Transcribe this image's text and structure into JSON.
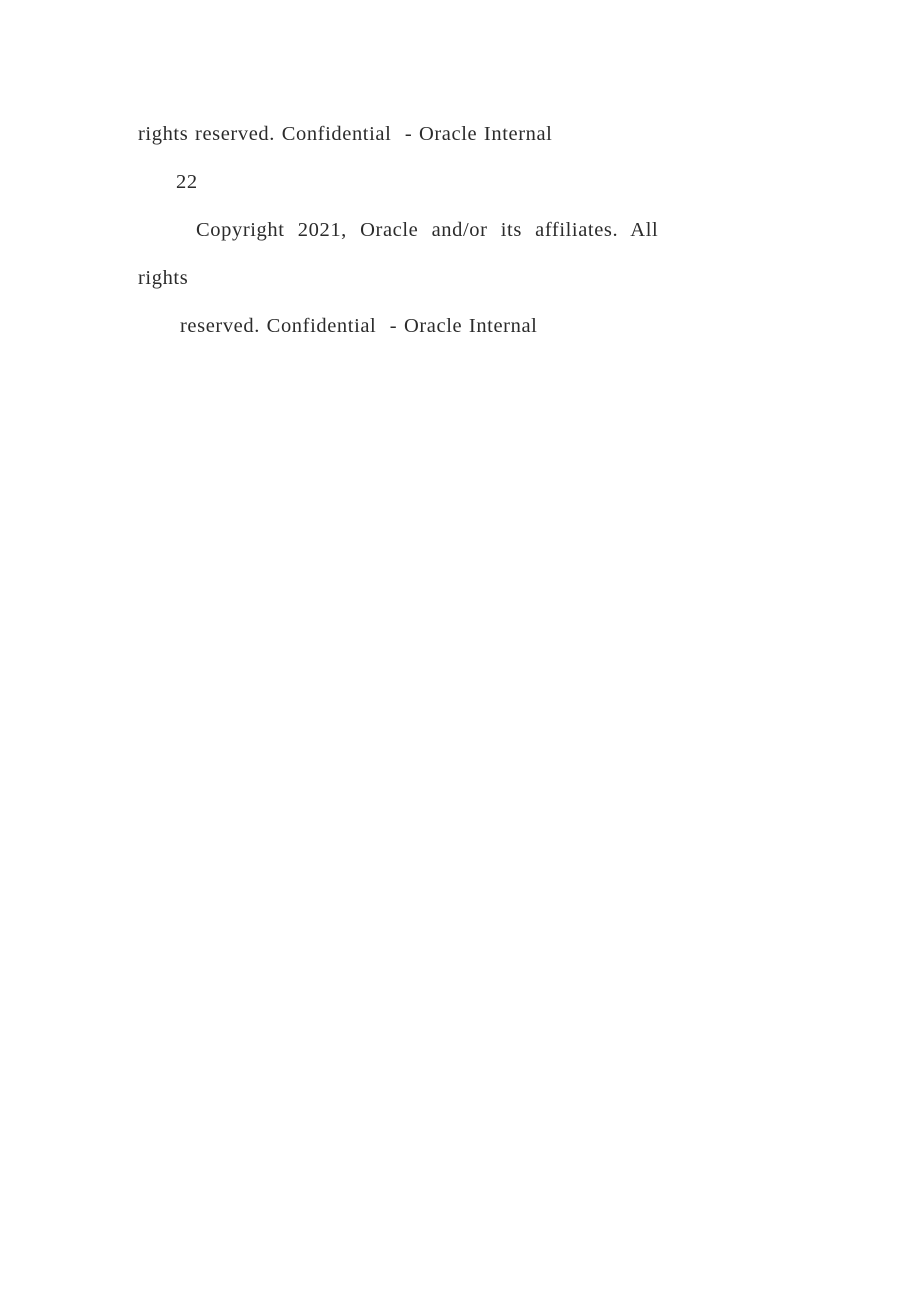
{
  "document": {
    "page_background": "#ffffff",
    "text_color": "#2b2b2b",
    "page_number": "22",
    "lines": [
      {
        "id": "line-1",
        "text": "rights reserved. Confidential  - Oracle Internal",
        "indent": "none",
        "justified": false
      },
      {
        "id": "line-2",
        "text": "22",
        "indent": "small",
        "justified": false
      },
      {
        "id": "line-3",
        "text": "Copyright 2021, Oracle and/or its affiliates. All",
        "indent": "paragraph",
        "justified": true
      },
      {
        "id": "line-4",
        "text": "rights",
        "indent": "none",
        "justified": false
      },
      {
        "id": "line-5",
        "text": "reserved. Confidential  - Oracle Internal",
        "indent": "small",
        "justified": false
      }
    ],
    "copyright_notice": {
      "holder": "Oracle and/or its affiliates",
      "year": "2021",
      "rights_statement": "All rights reserved.",
      "classification": "Confidential  - Oracle Internal"
    }
  }
}
